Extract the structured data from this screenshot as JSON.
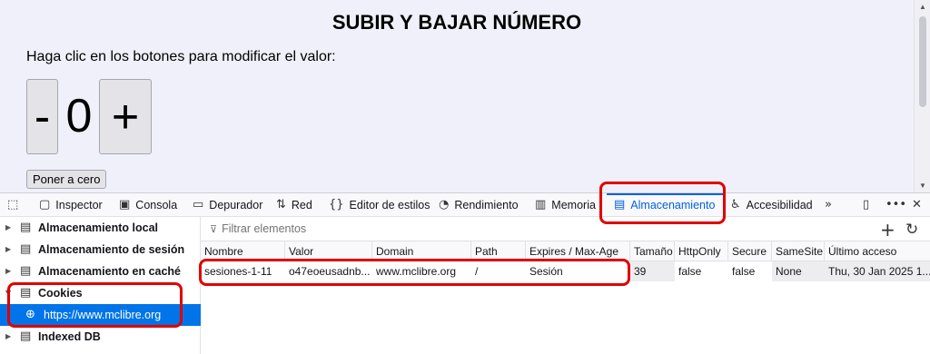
{
  "page": {
    "title": "SUBIR Y BAJAR NÚMERO",
    "hint": "Haga clic en los botones para modificar el valor:",
    "minus_label": "-",
    "value": "0",
    "plus_label": "+",
    "reset_label": "Poner a cero"
  },
  "toolbar": {
    "tabs": [
      {
        "label": "Inspector",
        "icon": "inspector-icon"
      },
      {
        "label": "Consola",
        "icon": "console-icon"
      },
      {
        "label": "Depurador",
        "icon": "debugger-icon"
      },
      {
        "label": "Red",
        "icon": "network-icon"
      },
      {
        "label": "Editor de estilos",
        "icon": "style-editor-icon"
      },
      {
        "label": "Rendimiento",
        "icon": "performance-icon"
      },
      {
        "label": "Memoria",
        "icon": "memory-icon"
      },
      {
        "label": "Almacenamiento",
        "icon": "storage-icon",
        "active": true
      },
      {
        "label": "Accesibilidad",
        "icon": "accessibility-icon"
      }
    ]
  },
  "sidebar": {
    "items": [
      {
        "label": "Almacenamiento local"
      },
      {
        "label": "Almacenamiento de sesión"
      },
      {
        "label": "Almacenamiento en caché"
      },
      {
        "label": "Cookies",
        "expanded": true
      },
      {
        "label": "https://www.mclibre.org",
        "selected": true
      },
      {
        "label": "Indexed DB"
      }
    ]
  },
  "filter": {
    "placeholder": "Filtrar elementos"
  },
  "table": {
    "headers": [
      "Nombre",
      "Valor",
      "Domain",
      "Path",
      "Expires / Max-Age",
      "Tamaño",
      "HttpOnly",
      "Secure",
      "SameSite",
      "Último acceso"
    ],
    "rows": [
      [
        "sesiones-1-11",
        "o47eoeusadnb...",
        "www.mclibre.org",
        "/",
        "Sesión",
        "39",
        "false",
        "false",
        "None",
        "Thu, 30 Jan 2025 1..."
      ]
    ]
  },
  "colors": {
    "accent": "#0061e0",
    "highlight": "#e00000",
    "selected_bg": "#0074e8"
  }
}
